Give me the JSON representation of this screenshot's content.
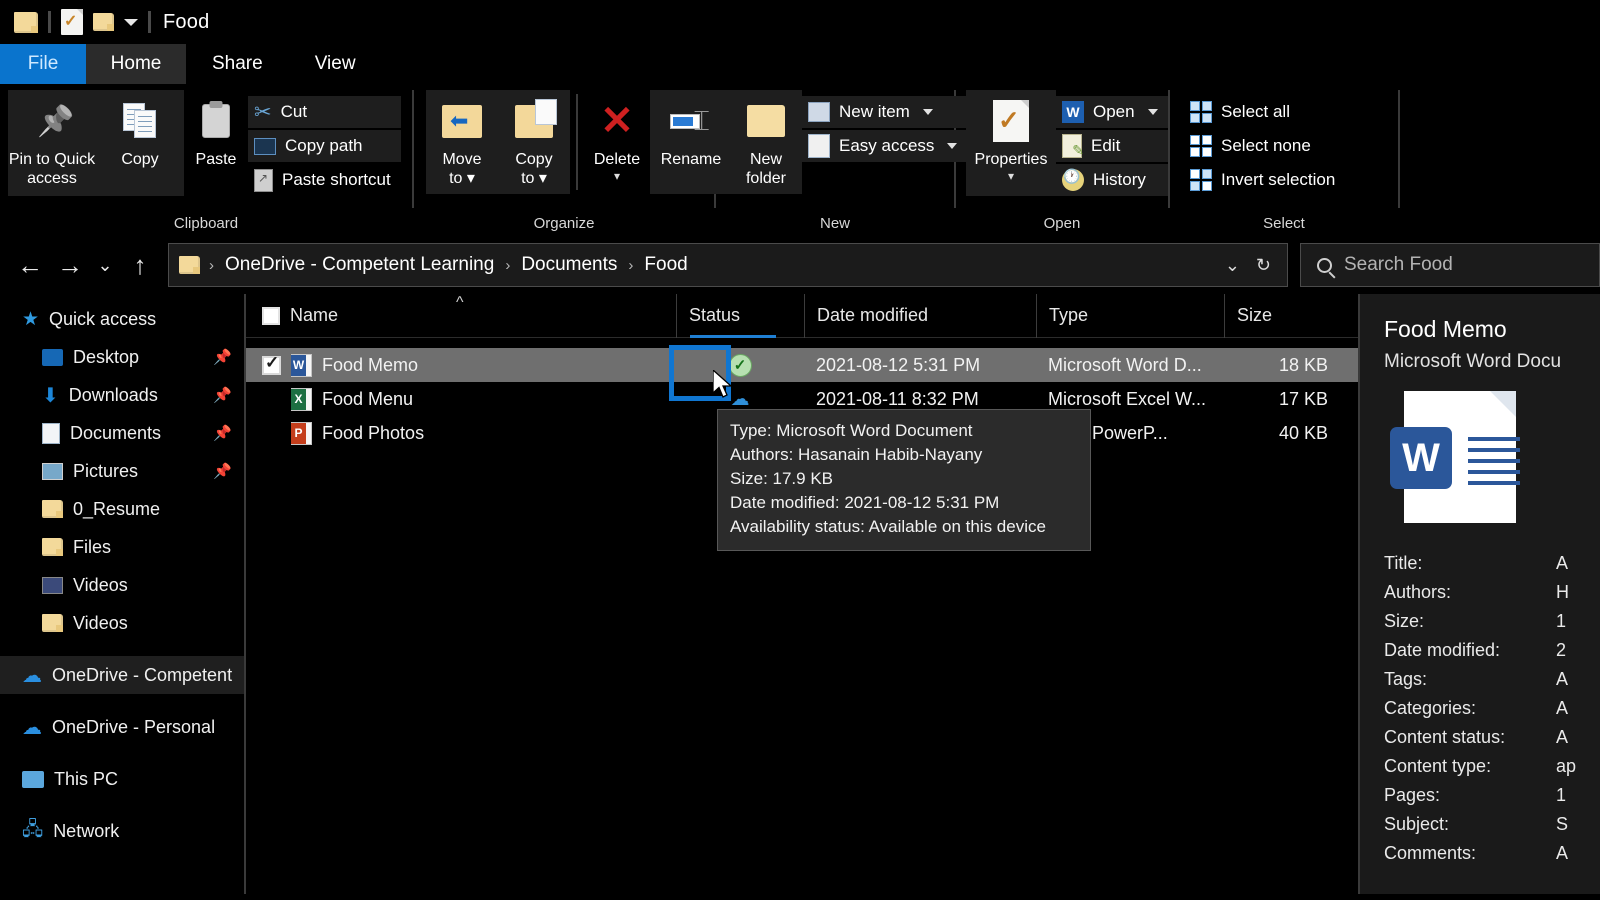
{
  "titlebar": {
    "title": "Food",
    "qat": [
      {
        "name": "folder-icon",
        "label": "Folder"
      },
      {
        "name": "properties-icon",
        "label": "Properties"
      },
      {
        "name": "new-folder-icon",
        "label": "New folder"
      },
      {
        "name": "chevron-down-icon",
        "label": "Customize Quick Access Toolbar"
      }
    ]
  },
  "tabs": [
    {
      "label": "File",
      "active": false
    },
    {
      "label": "Home",
      "active": true
    },
    {
      "label": "Share",
      "active": false
    },
    {
      "label": "View",
      "active": false
    }
  ],
  "ribbon": {
    "groups": [
      {
        "label": "Clipboard"
      },
      {
        "label": "Organize"
      },
      {
        "label": "New"
      },
      {
        "label": "Open"
      },
      {
        "label": "Select"
      }
    ],
    "clipboard": {
      "pin_label": "Pin to Quick\naccess",
      "pin_line1": "Pin to Quick",
      "pin_line2": "access",
      "copy": "Copy",
      "paste": "Paste",
      "cut": "Cut",
      "copy_path": "Copy path",
      "paste_shortcut": "Paste shortcut"
    },
    "organize": {
      "move_to_l1": "Move",
      "move_to_l2": "to",
      "copy_to_l1": "Copy",
      "copy_to_l2": "to",
      "delete": "Delete",
      "rename": "Rename"
    },
    "new": {
      "new_folder_l1": "New",
      "new_folder_l2": "folder",
      "new_item": "New item",
      "easy_access": "Easy access"
    },
    "open": {
      "properties": "Properties",
      "open": "Open",
      "edit": "Edit",
      "history": "History"
    },
    "select": {
      "select_all": "Select all",
      "select_none": "Select none",
      "invert_selection": "Invert selection"
    }
  },
  "address": {
    "back_icon": "←",
    "forward_icon": "→",
    "recent_icon": "⌄",
    "up_icon": "↑",
    "crumbs": [
      "OneDrive - Competent Learning",
      "Documents",
      "Food"
    ],
    "dropdown_icon": "⌄",
    "refresh_icon": "↻",
    "search_placeholder": "Search Food"
  },
  "sidebar": {
    "items": [
      {
        "label": "Quick access",
        "icon": "star-icon",
        "pinned": false,
        "indent": false,
        "selected": false
      },
      {
        "label": "Desktop",
        "icon": "desktop-icon",
        "pinned": true,
        "indent": true,
        "selected": false
      },
      {
        "label": "Downloads",
        "icon": "download-icon",
        "pinned": true,
        "indent": true,
        "selected": false
      },
      {
        "label": "Documents",
        "icon": "document-icon",
        "pinned": true,
        "indent": true,
        "selected": false
      },
      {
        "label": "Pictures",
        "icon": "pictures-icon",
        "pinned": true,
        "indent": true,
        "selected": false
      },
      {
        "label": "0_Resume",
        "icon": "folder-icon",
        "pinned": false,
        "indent": true,
        "selected": false
      },
      {
        "label": "Files",
        "icon": "folder-icon",
        "pinned": false,
        "indent": true,
        "selected": false
      },
      {
        "label": "Videos",
        "icon": "video-icon",
        "pinned": false,
        "indent": true,
        "selected": false
      },
      {
        "label": "Videos",
        "icon": "folder-icon",
        "pinned": false,
        "indent": true,
        "selected": false
      },
      {
        "label": "OneDrive - Competent",
        "icon": "onedrive-icon",
        "pinned": false,
        "indent": false,
        "selected": true
      },
      {
        "label": "OneDrive - Personal",
        "icon": "onedrive-icon",
        "pinned": false,
        "indent": false,
        "selected": false
      },
      {
        "label": "This PC",
        "icon": "pc-icon",
        "pinned": false,
        "indent": false,
        "selected": false
      },
      {
        "label": "Network",
        "icon": "network-icon",
        "pinned": false,
        "indent": false,
        "selected": false
      }
    ]
  },
  "filelist": {
    "columns": [
      "Name",
      "Status",
      "Date modified",
      "Type",
      "Size"
    ],
    "sort_indicator": "^",
    "rows": [
      {
        "name": "Food Memo",
        "icon": "word-file-icon",
        "status_icon": "available-on-device-icon",
        "date_modified": "2021-08-12 5:31 PM",
        "type": "Microsoft Word D...",
        "size": "18 KB",
        "checked": true,
        "selected": true
      },
      {
        "name": "Food Menu",
        "icon": "excel-file-icon",
        "status_icon": "cloud-only-icon",
        "date_modified": "2021-08-11 8:32 PM",
        "type": "Microsoft Excel W...",
        "size": "17 KB",
        "checked": false,
        "selected": false
      },
      {
        "name": "Food Photos",
        "icon": "powerpoint-file-icon",
        "status_icon": "cloud-only-icon",
        "date_modified": "",
        "type": "osoft PowerP...",
        "size": "40 KB",
        "checked": false,
        "selected": false
      }
    ]
  },
  "tooltip": {
    "lines": [
      "Type: Microsoft Word Document",
      "Authors: Hasanain Habib-Nayany",
      "Size: 17.9 KB",
      "Date modified: 2021-08-12 5:31 PM",
      "Availability status: Available on this device"
    ]
  },
  "preview": {
    "title": "Food Memo",
    "subtitle": "Microsoft Word Docu",
    "icon_letter": "W",
    "properties": [
      {
        "label": "Title:",
        "value": "A"
      },
      {
        "label": "Authors:",
        "value": "H"
      },
      {
        "label": "Size:",
        "value": "1"
      },
      {
        "label": "Date modified:",
        "value": "2"
      },
      {
        "label": "Tags:",
        "value": "A"
      },
      {
        "label": "Categories:",
        "value": "A"
      },
      {
        "label": "Content status:",
        "value": "A"
      },
      {
        "label": "Content type:",
        "value": "ap"
      },
      {
        "label": "Pages:",
        "value": "1"
      },
      {
        "label": "Subject:",
        "value": "S"
      },
      {
        "label": "Comments:",
        "value": "A"
      }
    ]
  },
  "colors": {
    "accent": "#0a74cd",
    "selection_box": "#1076d1",
    "row_selected": "#6f6f6f",
    "background": "#000000"
  }
}
